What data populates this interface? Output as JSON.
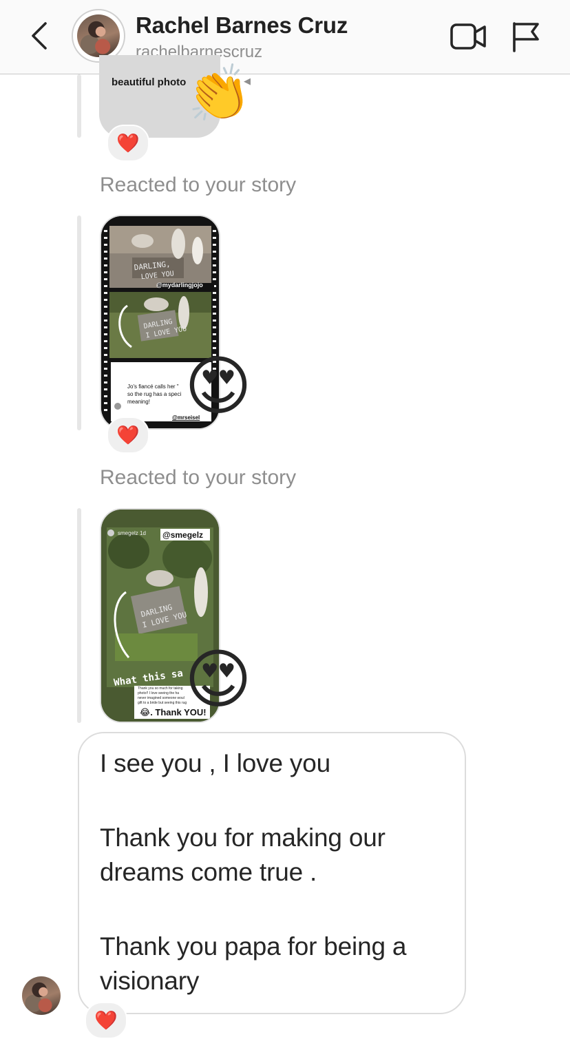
{
  "header": {
    "name": "Rachel Barnes Cruz",
    "username": "rachelbarnescruz",
    "icons": [
      "back-chevron-icon",
      "video-camera-icon",
      "flag-icon"
    ]
  },
  "messages": {
    "bubble1": {
      "caption": "beautiful photo",
      "emoji": "👏",
      "reaction": "❤️"
    },
    "story1": {
      "label": "Reacted to your story",
      "sign_text": "DARLING, I LOVE YOU",
      "handle": "@mydarlingjojo",
      "quote": "Jo's fiancé calls her \"",
      "quote_line2": "so the rug has a speci",
      "quote_line3": "meaning!",
      "credit": "@mrseisel",
      "reaction_emoji": "😍",
      "reaction": "❤️"
    },
    "story2": {
      "label": "Reacted to your story",
      "top_user": "smegelz 1d",
      "tag": "@smegelz",
      "sign_text": "DARLING I LOVE YOU",
      "overlay": "What this sa",
      "note_line1": "Thank you so much for taking",
      "note_line2": "photo!! I love seeing the ha",
      "note_line3": "never imagined someone woul",
      "note_line4": "gift to a bride but seeing this rug",
      "thank_you": "😂. Thank YOU!",
      "reaction_emoji": "😍"
    },
    "text_message": {
      "line1": "I see you , I love you",
      "line2": "Thank you for making our",
      "line3": "dreams come true .",
      "line4": "Thank you papa for being a",
      "line5": "visionary",
      "reaction": "❤️"
    }
  },
  "colors": {
    "text_primary": "#262626",
    "text_secondary": "#8e8e8e",
    "heart": "#e8172e",
    "header_bg": "#fafafa"
  }
}
